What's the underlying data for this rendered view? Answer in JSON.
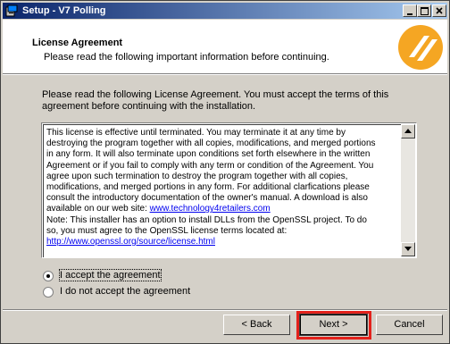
{
  "window": {
    "title": "Setup - V7 Polling",
    "icon": "setup-icon",
    "controls": [
      "minimize",
      "maximize",
      "close"
    ]
  },
  "header": {
    "title": "License Agreement",
    "subtitle": "Please read the following important information before continuing.",
    "logo": "brand-logo-icon"
  },
  "intro": "Please read the following License Agreement. You must accept the terms of this agreement before continuing with the installation.",
  "license": {
    "lines": [
      "This license is effective until terminated.  You may terminate it at any time by",
      "destroying the program together with all copies, modifications, and merged portions",
      "in any form.  It will also terminate upon conditions set forth elsewhere in the written",
      "Agreement or if you fail to comply with any term or condition of the Agreement.  You",
      "agree upon such termination to destroy the program together with all copies,",
      "modifications, and merged portions in any form.  For additional clarfications please",
      "consult the introductory documentation of the owner's manual.  A download is also",
      "available on our web site: ",
      "Note: This installer has an option to install DLLs from the OpenSSL project.  To do",
      "so, you must agree to the OpenSSL license terms located at:"
    ],
    "website_link": "www.technology4retailers.com",
    "openssl_link": "http://www.openssl.org/source/license.html"
  },
  "options": {
    "accept": "I accept the agreement",
    "decline": "I do not accept the agreement",
    "selected": "accept"
  },
  "buttons": {
    "back": "< Back",
    "next": "Next >",
    "cancel": "Cancel"
  },
  "colors": {
    "highlight": "#e3211b",
    "logo": "#f5a623"
  }
}
